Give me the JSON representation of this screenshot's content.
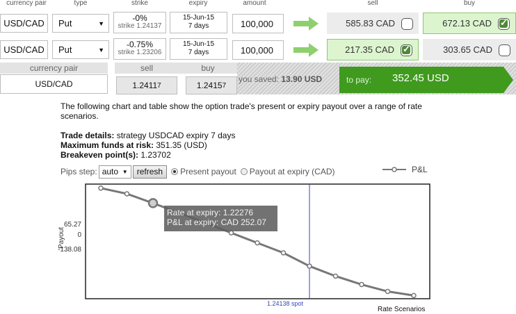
{
  "headers": {
    "currency_pair": "currency pair",
    "type": "type",
    "strike": "strike",
    "expiry": "expiry",
    "amount": "amount",
    "sell": "sell",
    "buy": "buy"
  },
  "rows": [
    {
      "pair": "USD/CAD",
      "type": "Put",
      "strike_pct": "-0%",
      "strike_value": "strike 1.24137",
      "expiry_date": "15-Jun-15",
      "expiry_days": "7 days",
      "amount": "100,000",
      "sell": "585.83 CAD",
      "sell_selected": false,
      "buy": "672.13 CAD",
      "buy_selected": true
    },
    {
      "pair": "USD/CAD",
      "type": "Put",
      "strike_pct": "-0.75%",
      "strike_value": "strike 1.23206",
      "expiry_date": "15-Jun-15",
      "expiry_days": "7 days",
      "amount": "100,000",
      "sell": "217.35 CAD",
      "sell_selected": true,
      "buy": "303.65 CAD",
      "buy_selected": false
    }
  ],
  "summary": {
    "currency_pair_label": "currency pair",
    "sell_label": "sell",
    "buy_label": "buy",
    "pair": "USD/CAD",
    "sell_main": "1.2411",
    "sell_pip": "7",
    "buy_main": "1.2415",
    "buy_pip": "7",
    "saved_label": "you saved:",
    "saved_value": "13.90 USD",
    "topay_label": "to pay:",
    "topay_value": "352.45 USD"
  },
  "info": {
    "description": "The following chart and table show the option trade's present or expiry payout over a range of rate scenarios.",
    "trade_details_label": "Trade details:",
    "trade_details_value": "strategy USDCAD expiry 7 days",
    "max_funds_label": "Maximum funds at risk:",
    "max_funds_value": "351.35 (USD)",
    "breakeven_label": "Breakeven point(s):",
    "breakeven_value": "1.23702"
  },
  "controls": {
    "pips_step_label": "Pips step:",
    "pips_step_value": "auto",
    "refresh_label": "refresh",
    "present_payout_label": "Present payout",
    "expiry_payout_label": "Payout at expiry (CAD)",
    "selected_mode": "present"
  },
  "chart_data": {
    "type": "line",
    "ylabel": "Payout",
    "xlabel": "Rate Scenarios",
    "yticks": [
      "65.27",
      "0",
      "-138.08"
    ],
    "spot_label": "1.24138 spot",
    "legend": "P&L",
    "series": [
      {
        "name": "P&L",
        "values": [
          345,
          310,
          252.07,
          192,
          130,
          68,
          6,
          -56,
          -138.08,
          -200,
          -252,
          -295,
          -320
        ]
      }
    ],
    "highlight_index": 2,
    "spot_index": 8,
    "ylim": [
      -340,
      370
    ],
    "tooltip": {
      "line1": "Rate at expiry: 1.22276",
      "line2": "P&L at expiry: CAD 252.07"
    }
  },
  "colors": {
    "accent_green": "#3f9a1e",
    "selected_bg": "#dcf5cf",
    "spot_line": "#3344bb"
  }
}
